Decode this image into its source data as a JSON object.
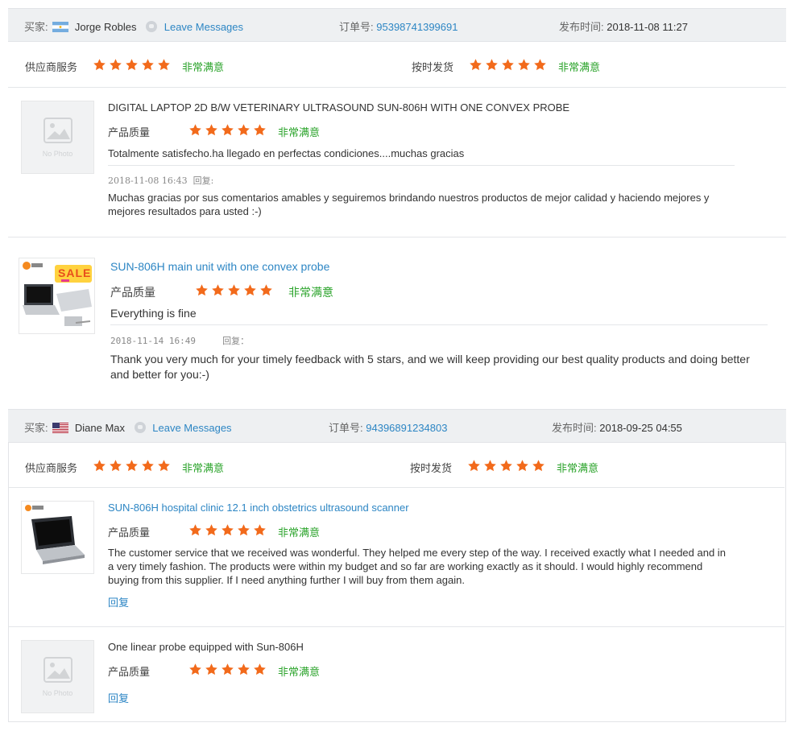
{
  "labels": {
    "buyer": "买家:",
    "order_no": "订单号:",
    "post_time": "发布时间:",
    "supplier_service": "供应商服务",
    "on_time_delivery": "按时发货",
    "product_quality": "产品质量",
    "very_satisfied": "非常满意",
    "leave_messages": "Leave Messages",
    "reply_prefix": "回复:",
    "reply_prefix_b": "回复：",
    "reply_link": "回复",
    "no_photo": "No Photo"
  },
  "reviews": [
    {
      "buyer_name": "Jorge Robles",
      "buyer_flag": "argentina-flag",
      "order_number": "95398741399691",
      "posted": "2018-11-08 11:27",
      "supplier_service_stars": 5,
      "on_time_delivery_stars": 5,
      "items": [
        {
          "title": "DIGITAL LAPTOP 2D B/W VETERINARY ULTRASOUND SUN-806H WITH ONE CONVEX PROBE",
          "quality_stars": 5,
          "comment": "Totalmente satisfecho.ha llegado en perfectas condiciones....muchas gracias",
          "reply_date": "2018-11-08 16:43",
          "reply": "Muchas gracias por sus comentarios amables y seguiremos brindando nuestros productos de mejor calidad y haciendo mejores y mejores resultados para usted :-)"
        },
        {
          "title": "SUN-806H main unit with one convex probe",
          "quality_stars": 5,
          "comment": "Everything is fine",
          "reply_date": "2018-11-14 16:49",
          "reply": "Thank you very much for your timely feedback with 5 stars, and we will keep providing our best quality products and doing better and better for you:-)",
          "thumb_badge": "SALE"
        }
      ]
    },
    {
      "buyer_name": "Diane Max",
      "buyer_flag": "usa-flag",
      "order_number": "94396891234803",
      "posted": "2018-09-25 04:55",
      "supplier_service_stars": 5,
      "on_time_delivery_stars": 5,
      "items": [
        {
          "title": "SUN-806H hospital clinic 12.1 inch obstetrics ultrasound scanner",
          "quality_stars": 5,
          "comment": "The customer service that we received was wonderful. They helped me every step of the way. I received exactly what I needed and in a very timely fashion. The products were within my budget and so far are working exactly as it should. I would highly recommend buying from this supplier. If I need anything further I will buy from them again."
        },
        {
          "title": "One linear probe equipped with Sun-806H",
          "quality_stars": 5
        }
      ]
    }
  ],
  "colors": {
    "star": "#f26a1b",
    "link": "#2d86c4",
    "satisfied": "#2aa32a",
    "header_bg": "#eef0f2"
  }
}
